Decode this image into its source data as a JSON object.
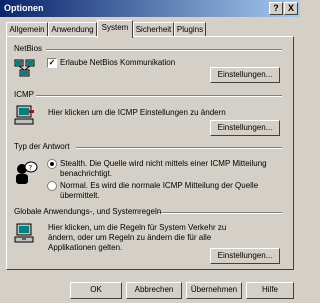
{
  "window": {
    "title": "Optionen",
    "help_btn": "?",
    "close_btn": "X"
  },
  "tabs": [
    "Allgemein",
    "Anwendung",
    "System",
    "Sicherheit",
    "Plugins"
  ],
  "sections": {
    "netbios": {
      "label": "NetBios",
      "checkbox_label": "Erlaube NetBios Kommunikation",
      "checked": true,
      "button": "Einstellungen..."
    },
    "icmp": {
      "label": "ICMP",
      "text": "Hier klicken um die ICMP Einstellungen zu ändern",
      "button": "Einstellungen..."
    },
    "response": {
      "label": "Typ der Antwort",
      "option1": "Stealth. Die Quelle wird nicht mittels einer ICMP Mitteilung benachrichtigt.",
      "option2": "Normal. Es wird die normale ICMP Mitteilung der Quelle übermittelt.",
      "selected": 1
    },
    "global": {
      "label": "Globale Anwendungs-, und Systemregeln",
      "text": "Hier klicken, um die Regeln für System Verkehr zu ändern, oder um Regeln zu ändern die für alle Applikationen gelten.",
      "button": "Einstellungen..."
    }
  },
  "footer": {
    "ok": "OK",
    "cancel": "Abbrechen",
    "apply": "Übernehmen",
    "help": "Hilfe"
  }
}
